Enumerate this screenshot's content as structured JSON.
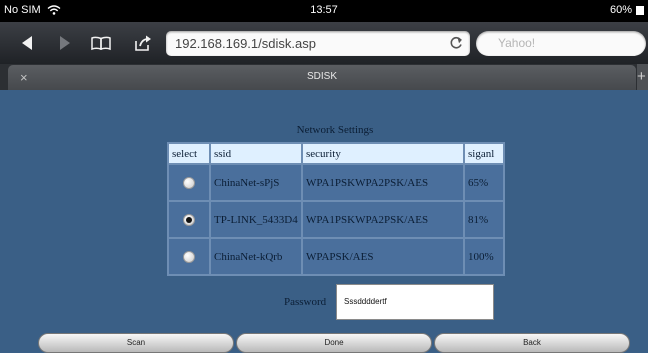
{
  "status_bar": {
    "carrier": "No SIM",
    "time": "13:57",
    "battery": "60%"
  },
  "toolbar": {
    "back_icon": "back-arrow-icon",
    "forward_icon": "forward-arrow-icon",
    "bookmarks_icon": "bookmarks-book-icon",
    "share_icon": "share-icon",
    "url": "192.168.169.1/sdisk.asp",
    "reload_icon": "reload-icon",
    "search_placeholder": "Yahoo!"
  },
  "tab": {
    "close_label": "×",
    "title": "SDISK",
    "new_tab_label": "+"
  },
  "page": {
    "caption": "Network Settings",
    "columns": [
      "select",
      "ssid",
      "security",
      "siganl"
    ],
    "rows": [
      {
        "selected": false,
        "ssid": "ChinaNet-sPjS",
        "security": "WPA1PSKWPA2PSK/AES",
        "signal": "65%"
      },
      {
        "selected": true,
        "ssid": "TP-LINK_5433D4",
        "security": "WPA1PSKWPA2PSK/AES",
        "signal": "81%"
      },
      {
        "selected": false,
        "ssid": "ChinaNet-kQrb",
        "security": "WPAPSK/AES",
        "signal": "100%"
      }
    ],
    "password_label": "Password",
    "password_value": "Sssddddertf",
    "buttons": {
      "scan": "Scan",
      "done": "Done",
      "back": "Back"
    }
  },
  "colors": {
    "page_background": "#3a5f86",
    "table_header": "#dff0ff",
    "table_cell": "#4a6f9c"
  }
}
